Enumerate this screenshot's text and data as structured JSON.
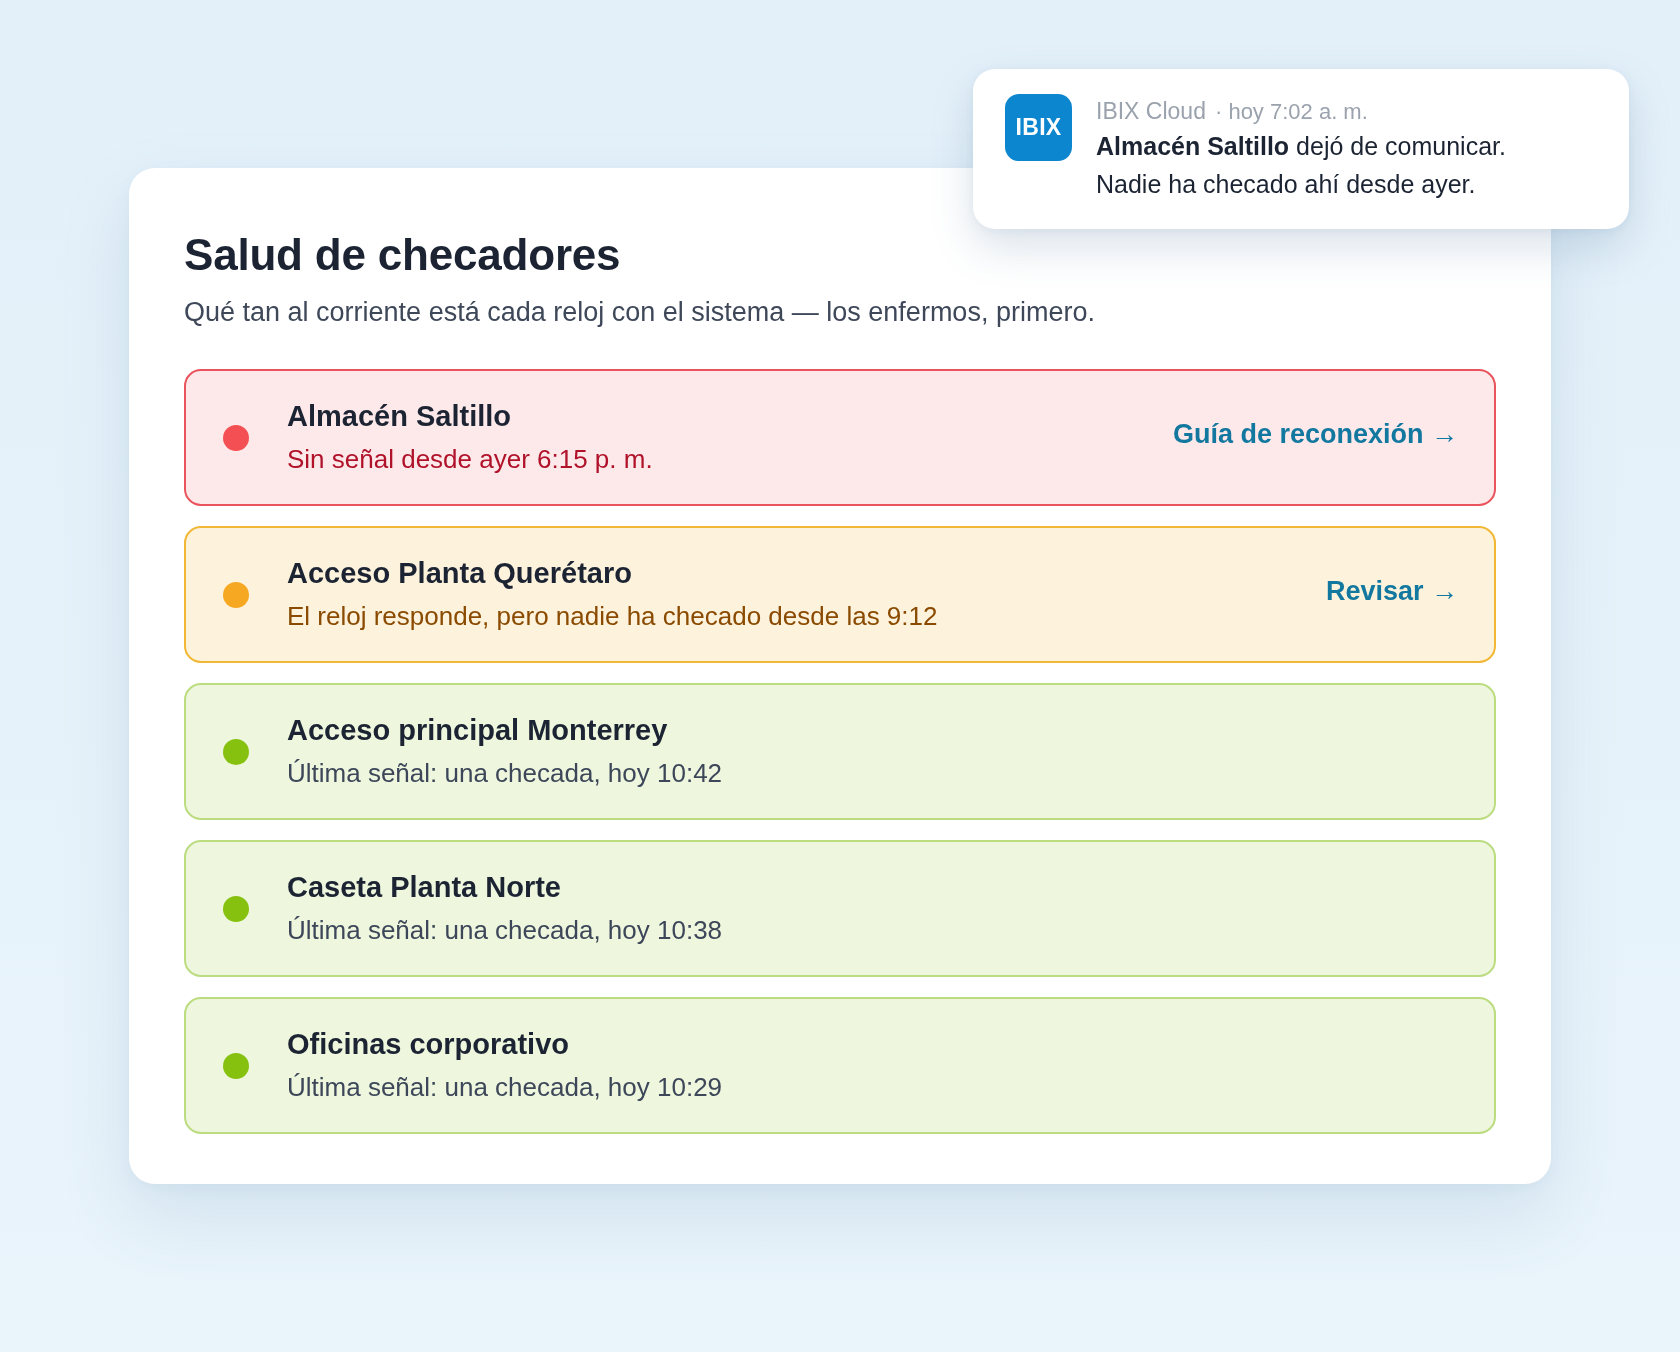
{
  "panel": {
    "title": "Salud de checadores",
    "subtitle": "Qué tan al corriente está cada reloj con el sistema — los enfermos, primero."
  },
  "checkers": [
    {
      "kind": "alert",
      "color": "#f44f52",
      "name": "Almacén Saltillo",
      "status": "Sin señal desde ayer 6:15 p. m.",
      "action": "Guía de reconexión →"
    },
    {
      "kind": "warning",
      "color": "#f6a823",
      "name": "Acceso Planta Querétaro",
      "status": "El reloj responde, pero nadie ha checado desde las 9:12",
      "action": "Revisar →"
    },
    {
      "kind": "ok",
      "color": "#86c10f",
      "name": "Acceso principal Monterrey",
      "status": "Última señal: una checada, hoy 10:42"
    },
    {
      "kind": "ok",
      "color": "#86c10f",
      "name": "Caseta Planta Norte",
      "status": "Última señal: una checada, hoy 10:38"
    },
    {
      "kind": "ok",
      "color": "#86c10f",
      "name": "Oficinas corporativo",
      "status": "Última señal: una checada, hoy 10:29"
    }
  ],
  "notification": {
    "app_logo": "IBIX",
    "source": "IBIX Cloud",
    "time": "· hoy 7:02 a. m.",
    "message": "**Almacén Saltillo** dejó de comunicar.\nNadie ha checado ahí desde ayer."
  }
}
